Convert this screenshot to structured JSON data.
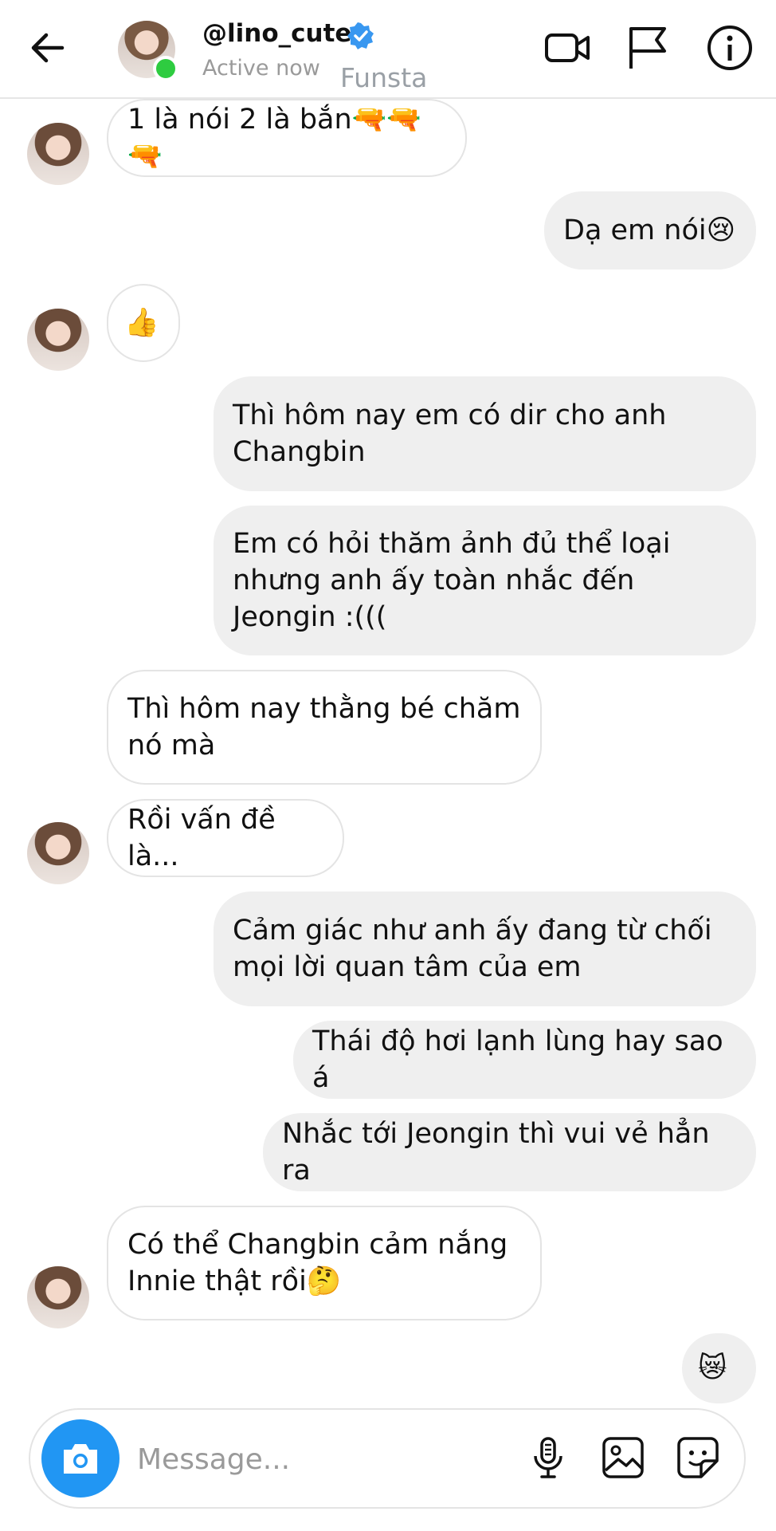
{
  "header": {
    "username": "@lino_cute",
    "status": "Active now",
    "funsta_label": "Funsta"
  },
  "messages": [
    {
      "side": "in",
      "text": "1 là nói 2 là bắn🔫🔫🔫"
    },
    {
      "side": "out",
      "text": "Dạ em nói😢"
    },
    {
      "side": "in",
      "text": "👍"
    },
    {
      "side": "out",
      "text": "Thì hôm nay em có dir cho anh Changbin"
    },
    {
      "side": "out",
      "text": "Em có hỏi thăm ảnh đủ thể loại nhưng anh ấy toàn nhắc đến Jeongin :((("
    },
    {
      "side": "in",
      "text": "Thì hôm nay thằng bé chăm nó mà"
    },
    {
      "side": "in",
      "text": "Rồi vấn đề là..."
    },
    {
      "side": "out",
      "text": "Cảm giác như anh ấy đang từ chối mọi lời quan tâm của em"
    },
    {
      "side": "out",
      "text": "Thái độ hơi lạnh lùng hay sao á"
    },
    {
      "side": "out",
      "text": "Nhắc tới Jeongin thì vui vẻ hẳn ra"
    },
    {
      "side": "in",
      "text": "Có thể Changbin cảm nắng Innie thật rồi🤔"
    },
    {
      "side": "out",
      "text": "😿"
    }
  ],
  "composer": {
    "placeholder": "Message..."
  },
  "icons": {
    "back": "arrow-left-icon",
    "verified": "verified-badge-icon",
    "video": "video-camera-icon",
    "flag": "flag-icon",
    "info": "info-icon",
    "camera": "camera-icon",
    "mic": "microphone-icon",
    "gallery": "image-icon",
    "sticker": "sticker-icon"
  },
  "colors": {
    "accent": "#2196f3",
    "verified": "#3897f0",
    "online": "#2ecc40",
    "outgoing_bubble": "#efefef"
  }
}
